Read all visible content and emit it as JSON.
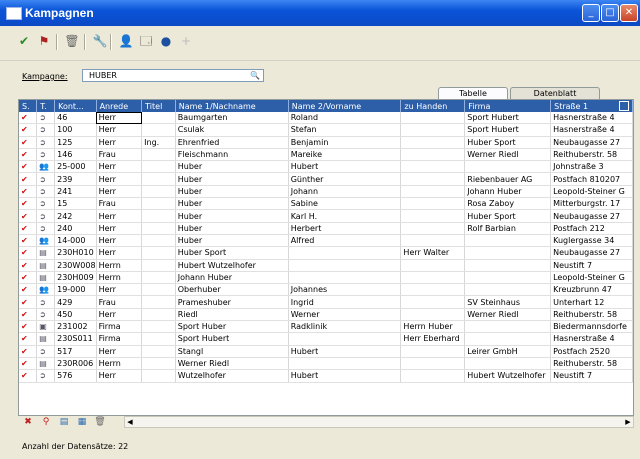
{
  "window": {
    "title": "Kampagnen"
  },
  "window_buttons": [
    {
      "name": "minimize-button",
      "glyph": "_"
    },
    {
      "name": "maximize-button",
      "glyph": "□"
    },
    {
      "name": "close-button",
      "glyph": "✕"
    }
  ],
  "toolbar": [
    {
      "name": "checkmark-icon",
      "glyph": "✔",
      "color": "#2a8a2a"
    },
    {
      "name": "flag-icon",
      "glyph": "⚑",
      "color": "#b02020"
    },
    {
      "name": "trash-icon",
      "glyph": "🗑",
      "color": "#666666"
    },
    {
      "name": "wrench-icon",
      "glyph": "🔧",
      "color": "#555555"
    },
    {
      "name": "user-icon",
      "glyph": "👤",
      "color": "#444444"
    },
    {
      "name": "window-icon",
      "glyph": "🗔",
      "color": "#333333"
    },
    {
      "name": "disc-icon",
      "glyph": "●",
      "color": "#1d4fa0"
    },
    {
      "name": "plus-icon",
      "glyph": "+",
      "color": "#bbbbbb"
    }
  ],
  "search": {
    "label": "Kampagne:",
    "value": "HUBER"
  },
  "tabs": [
    {
      "label": "Tabelle"
    },
    {
      "label": "Datenblatt"
    }
  ],
  "table": {
    "columns": [
      "S.",
      "T.",
      "Kont...",
      "Anrede",
      "Titel",
      "Name 1/Nachname",
      "Name 2/Vorname",
      "zu Handen",
      "Firma",
      "Straße 1"
    ],
    "rows": [
      {
        "type": "person",
        "cells": [
          "46",
          "Herr",
          "",
          "Baumgarten",
          "Roland",
          "",
          "Sport Hubert",
          "Hasnerstraße 4"
        ]
      },
      {
        "type": "person",
        "cells": [
          "100",
          "Herr",
          "",
          "Csulak",
          "Stefan",
          "",
          "Sport Hubert",
          "Hasnerstraße 4"
        ]
      },
      {
        "type": "person",
        "cells": [
          "125",
          "Herr",
          "Ing.",
          "Ehrenfried",
          "Benjamin",
          "",
          "Huber Sport",
          "Neubaugasse 27"
        ]
      },
      {
        "type": "person",
        "cells": [
          "146",
          "Frau",
          "",
          "Fleischmann",
          "Mareike",
          "",
          "Werner Riedl",
          "Reithuberstr. 58"
        ]
      },
      {
        "type": "group",
        "cells": [
          "25-000",
          "Herr",
          "",
          "Huber",
          "Hubert",
          "",
          "",
          "Johnstraße 3"
        ]
      },
      {
        "type": "person",
        "cells": [
          "239",
          "Herr",
          "",
          "Huber",
          "Günther",
          "",
          "Riebenbauer AG",
          "Postfach 810207"
        ]
      },
      {
        "type": "person",
        "cells": [
          "241",
          "Herr",
          "",
          "Huber",
          "Johann",
          "",
          "Johann Huber",
          "Leopold-Steiner G"
        ]
      },
      {
        "type": "person",
        "cells": [
          "15",
          "Frau",
          "",
          "Huber",
          "Sabine",
          "",
          "Rosa Zaboy",
          "Mitterburgstr. 17"
        ]
      },
      {
        "type": "person",
        "cells": [
          "242",
          "Herr",
          "",
          "Huber",
          "Karl H.",
          "",
          "Huber Sport",
          "Neubaugasse 27"
        ]
      },
      {
        "type": "person",
        "cells": [
          "240",
          "Herr",
          "",
          "Huber",
          "Herbert",
          "",
          "Rolf Barbian",
          "Postfach 212"
        ]
      },
      {
        "type": "group",
        "cells": [
          "14-000",
          "Herr",
          "",
          "Huber",
          "Alfred",
          "",
          "",
          "Kuglergasse 34"
        ]
      },
      {
        "type": "company",
        "cells": [
          "230H010",
          "Herr",
          "",
          "Huber Sport",
          "",
          "Herr Walter",
          "",
          "Neubaugasse 27"
        ]
      },
      {
        "type": "company",
        "cells": [
          "230W008",
          "Herrn",
          "",
          "Hubert Wutzelhofer",
          "",
          "",
          "",
          "Neustift 7"
        ]
      },
      {
        "type": "company",
        "cells": [
          "230H009",
          "Herrn",
          "",
          "Johann Huber",
          "",
          "",
          "",
          "Leopold-Steiner G"
        ]
      },
      {
        "type": "group",
        "cells": [
          "19-000",
          "Herr",
          "",
          "Oberhuber",
          "Johannes",
          "",
          "",
          "Kreuzbrunn 47"
        ]
      },
      {
        "type": "person",
        "cells": [
          "429",
          "Frau",
          "",
          "Prameshuber",
          "Ingrid",
          "",
          "SV Steinhaus",
          "Unterhart 12"
        ]
      },
      {
        "type": "person",
        "cells": [
          "450",
          "Herr",
          "",
          "Riedl",
          "Werner",
          "",
          "Werner Riedl",
          "Reithuberstr. 58"
        ]
      },
      {
        "type": "company2",
        "cells": [
          "231002",
          "Firma",
          "",
          "Sport Huber",
          "Radklinik",
          "Herrn Huber",
          "",
          "Biedermannsdorfe"
        ]
      },
      {
        "type": "company",
        "cells": [
          "230S011",
          "Firma",
          "",
          "Sport Hubert",
          "",
          "Herr Eberhard",
          "",
          "Hasnerstraße 4"
        ]
      },
      {
        "type": "person",
        "cells": [
          "517",
          "Herr",
          "",
          "Stangl",
          "Hubert",
          "",
          "Leirer GmbH",
          "Postfach 2520"
        ]
      },
      {
        "type": "company",
        "cells": [
          "230R006",
          "Herrn",
          "",
          "Werner Riedl",
          "",
          "",
          "",
          "Reithuberstr. 58"
        ]
      },
      {
        "type": "person",
        "cells": [
          "576",
          "Herr",
          "",
          "Wutzelhofer",
          "Hubert",
          "",
          "Hubert Wutzelhofer",
          "Neustift 7"
        ]
      }
    ]
  },
  "footer": {
    "count_label": "Anzahl der Datensätze:",
    "count": "22"
  },
  "bottom_icons": [
    "remove-icon",
    "filter-icon",
    "export-icon",
    "chart-icon",
    "trash-icon"
  ]
}
